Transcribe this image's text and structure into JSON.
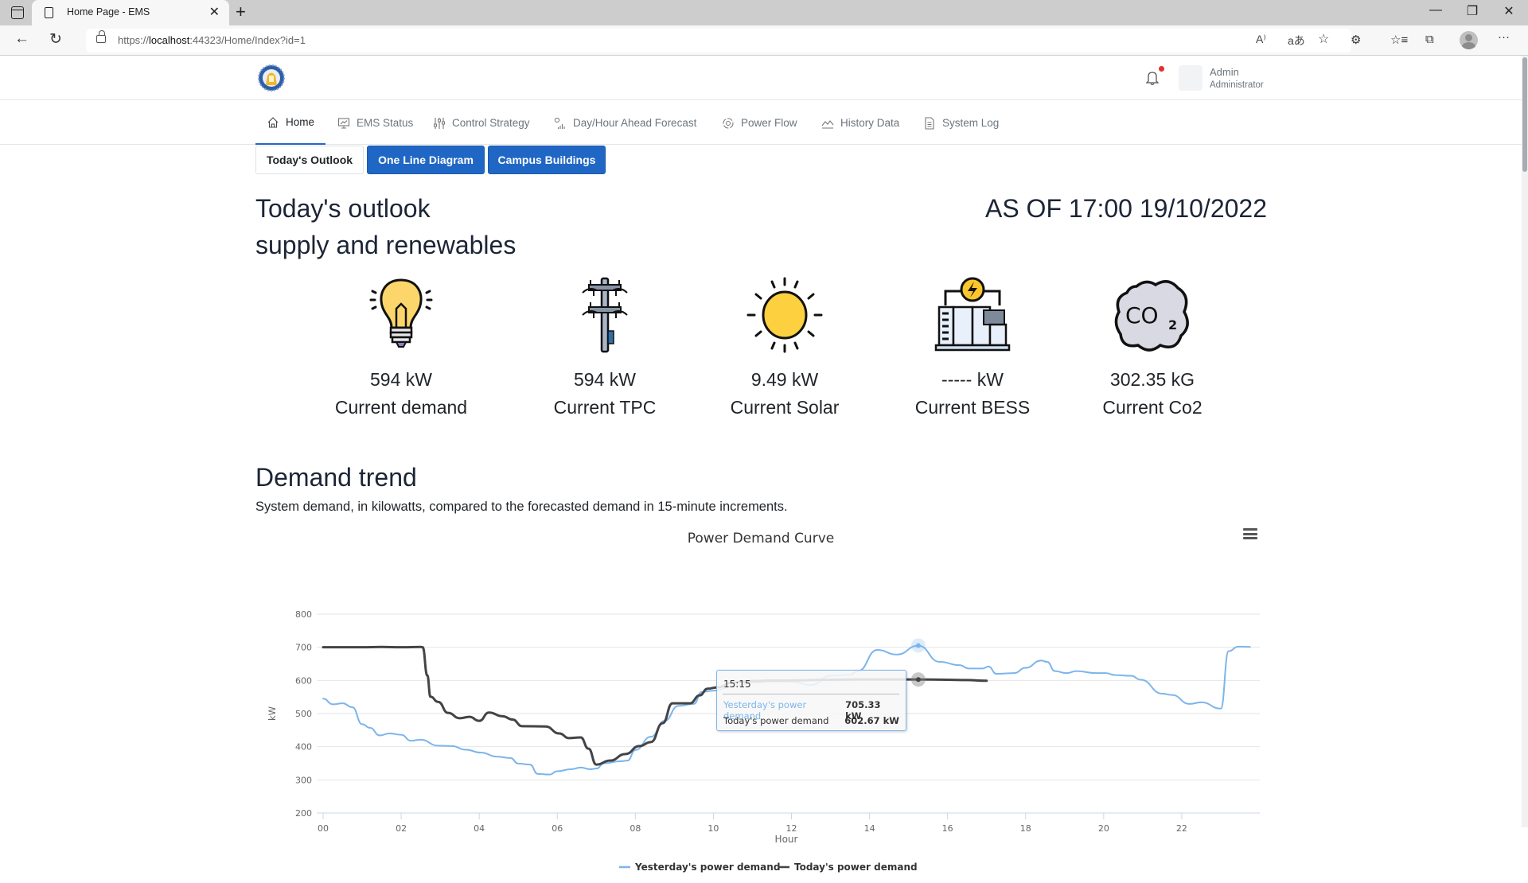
{
  "browser": {
    "tab_title": "Home Page - EMS",
    "url_prefix": "https://",
    "url_host": "localhost",
    "url_rest": ":44323/Home/Index?id=1",
    "read_aloud_icon": "A⁾",
    "translate_icon": "aあ"
  },
  "header": {
    "user_name": "Admin",
    "user_role": "Administrator",
    "has_notification": true
  },
  "nav": {
    "items": [
      {
        "label": "Home",
        "icon": "home-icon",
        "active": true
      },
      {
        "label": "EMS Status",
        "icon": "monitor-chart-icon",
        "active": false
      },
      {
        "label": "Control Strategy",
        "icon": "sliders-icon",
        "active": false
      },
      {
        "label": "Day/Hour Ahead Forecast",
        "icon": "forecast-icon",
        "active": false
      },
      {
        "label": "Power Flow",
        "icon": "power-flow-icon",
        "active": false
      },
      {
        "label": "History Data",
        "icon": "history-chart-icon",
        "active": false
      },
      {
        "label": "System Log",
        "icon": "document-icon",
        "active": false
      }
    ]
  },
  "subtabs": [
    {
      "label": "Today's Outlook",
      "style": "light"
    },
    {
      "label": "One Line Diagram",
      "style": "primary"
    },
    {
      "label": "Campus Buildings",
      "style": "primary"
    }
  ],
  "outlook": {
    "title": "Today's outlook",
    "subtitle": "supply and renewables",
    "as_of": "AS OF 17:00 19/10/2022"
  },
  "stats": [
    {
      "value": "594 kW",
      "label": "Current demand",
      "icon": "lightbulb-icon"
    },
    {
      "value": "594 kW",
      "label": "Current TPC",
      "icon": "power-pole-icon"
    },
    {
      "value": "9.49 kW",
      "label": "Current Solar",
      "icon": "sun-icon"
    },
    {
      "value": "----- kW",
      "label": "Current BESS",
      "icon": "battery-storage-icon"
    },
    {
      "value": "302.35 kG",
      "label": "Current Co2",
      "icon": "co2-cloud-icon"
    }
  ],
  "demand": {
    "title": "Demand trend",
    "subtitle": "System demand, in kilowatts, compared to the forecasted demand in 15-minute increments."
  },
  "colors": {
    "primary": "#2067c5",
    "yesterday": "#7cb5ec",
    "today": "#434348",
    "notification": "#e03131"
  },
  "chart_data": {
    "type": "line",
    "title": "Power Demand Curve",
    "xlabel": "Hour",
    "ylabel": "kW",
    "xlim": [
      0,
      24
    ],
    "ylim": [
      200,
      800
    ],
    "x_ticks": [
      "00",
      "02",
      "04",
      "06",
      "08",
      "10",
      "12",
      "14",
      "16",
      "18",
      "20",
      "22"
    ],
    "y_ticks": [
      800,
      700,
      600,
      500,
      400,
      300,
      200
    ],
    "grid": true,
    "legend_position": "bottom-center",
    "series": [
      {
        "name": "Yesterday's power demand",
        "points": [
          [
            0,
            545
          ],
          [
            0.25,
            528
          ],
          [
            0.5,
            531
          ],
          [
            0.75,
            519
          ],
          [
            1.0,
            468
          ],
          [
            1.2,
            457
          ],
          [
            1.45,
            434
          ],
          [
            1.7,
            440
          ],
          [
            2.0,
            436
          ],
          [
            2.25,
            418
          ],
          [
            2.5,
            421
          ],
          [
            2.95,
            403
          ],
          [
            3.3,
            402
          ],
          [
            3.65,
            391
          ],
          [
            4.05,
            382
          ],
          [
            4.45,
            370
          ],
          [
            4.8,
            366
          ],
          [
            5.0,
            349
          ],
          [
            5.3,
            346
          ],
          [
            5.5,
            318
          ],
          [
            5.8,
            316
          ],
          [
            6.0,
            326
          ],
          [
            6.35,
            332
          ],
          [
            6.6,
            337
          ],
          [
            6.85,
            332
          ],
          [
            7.0,
            334
          ],
          [
            7.2,
            350
          ],
          [
            7.6,
            356
          ],
          [
            7.8,
            358
          ],
          [
            8.0,
            390
          ],
          [
            8.4,
            430
          ],
          [
            8.75,
            478
          ],
          [
            9.1,
            523
          ],
          [
            9.5,
            529
          ],
          [
            9.7,
            565
          ],
          [
            10.0,
            569
          ],
          [
            10.5,
            582
          ],
          [
            11.0,
            593
          ],
          [
            11.5,
            597
          ],
          [
            12.0,
            596
          ],
          [
            12.5,
            586
          ],
          [
            13.0,
            614
          ],
          [
            13.5,
            617
          ],
          [
            13.7,
            628
          ],
          [
            14.2,
            692
          ],
          [
            14.7,
            678
          ],
          [
            15.25,
            705
          ],
          [
            15.8,
            656
          ],
          [
            16.3,
            646
          ],
          [
            16.55,
            636
          ],
          [
            16.9,
            636
          ],
          [
            17.05,
            642
          ],
          [
            17.25,
            620
          ],
          [
            17.7,
            622
          ],
          [
            18.0,
            638
          ],
          [
            18.4,
            660
          ],
          [
            18.55,
            656
          ],
          [
            18.75,
            628
          ],
          [
            19.05,
            622
          ],
          [
            19.3,
            628
          ],
          [
            19.8,
            622
          ],
          [
            20.05,
            622
          ],
          [
            20.3,
            616
          ],
          [
            20.7,
            614
          ],
          [
            20.95,
            602
          ],
          [
            21.5,
            560
          ],
          [
            21.75,
            556
          ],
          [
            22.2,
            529
          ],
          [
            22.5,
            534
          ],
          [
            23.0,
            515
          ],
          [
            23.2,
            688
          ],
          [
            23.45,
            702
          ],
          [
            23.75,
            701
          ]
        ]
      },
      {
        "name": "Today's power demand",
        "points": [
          [
            0,
            700
          ],
          [
            0.5,
            700
          ],
          [
            1.0,
            700
          ],
          [
            1.5,
            701
          ],
          [
            2.0,
            700
          ],
          [
            2.5,
            701
          ],
          [
            2.55,
            700
          ],
          [
            2.67,
            615
          ],
          [
            2.75,
            551
          ],
          [
            2.95,
            535
          ],
          [
            3.2,
            502
          ],
          [
            3.5,
            486
          ],
          [
            3.75,
            490
          ],
          [
            4.0,
            478
          ],
          [
            4.25,
            503
          ],
          [
            4.6,
            492
          ],
          [
            4.85,
            482
          ],
          [
            5.1,
            462
          ],
          [
            5.7,
            461
          ],
          [
            6.05,
            440
          ],
          [
            6.3,
            426
          ],
          [
            6.6,
            428
          ],
          [
            6.8,
            394
          ],
          [
            7.0,
            346
          ],
          [
            7.35,
            358
          ],
          [
            7.75,
            378
          ],
          [
            8.1,
            402
          ],
          [
            8.4,
            414
          ],
          [
            8.7,
            471
          ],
          [
            8.95,
            531
          ],
          [
            9.4,
            531
          ],
          [
            9.65,
            555
          ],
          [
            9.85,
            575
          ],
          [
            10.1,
            579
          ],
          [
            10.5,
            594
          ],
          [
            11.0,
            598
          ],
          [
            11.5,
            600
          ],
          [
            12.0,
            600
          ],
          [
            13.0,
            602
          ],
          [
            14.0,
            603
          ],
          [
            15.25,
            603
          ],
          [
            16.0,
            602
          ],
          [
            16.5,
            601
          ],
          [
            17.0,
            599
          ]
        ]
      }
    ],
    "tooltip": {
      "time": "15:15",
      "rows": [
        {
          "name": "Yesterday's power demand",
          "value": "705.33 kW"
        },
        {
          "name": "Today's power demand",
          "value": "602.67 kW"
        }
      ]
    }
  }
}
